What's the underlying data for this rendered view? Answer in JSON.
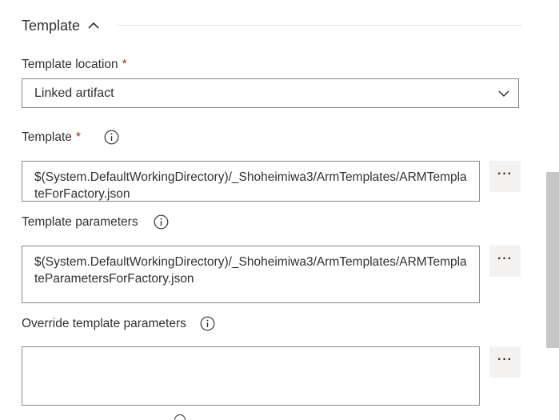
{
  "section": {
    "title": "Template",
    "expanded_icon": "chevron-up-icon"
  },
  "template_location": {
    "label": "Template location",
    "required_marker": "*",
    "selected_value": "Linked artifact",
    "dropdown_icon": "chevron-down-icon"
  },
  "template": {
    "label": "Template",
    "required_marker": "*",
    "info_icon": "info-icon",
    "value": "$(System.DefaultWorkingDirectory)/_Shoheimiwa3/ArmTemplates/ARMTemplateForFactory.json",
    "more_label": "···"
  },
  "template_parameters": {
    "label": "Template parameters",
    "info_icon": "info-icon",
    "value": "$(System.DefaultWorkingDirectory)/_Shoheimiwa3/ArmTemplates/ARMTemplateParametersForFactory.json",
    "more_label": "···"
  },
  "override_parameters": {
    "label": "Override template parameters",
    "info_icon": "info-icon",
    "value": "",
    "more_label": "···"
  },
  "colors": {
    "required": "#a4262c",
    "border": "#8a8886",
    "button_bg": "#f3f2f1",
    "scroll_thumb": "#c8c6c4",
    "text": "#323130"
  }
}
